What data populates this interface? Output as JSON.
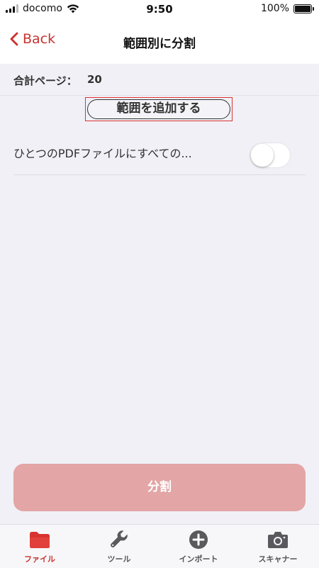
{
  "status_bar": {
    "carrier": "docomo",
    "time": "9:50",
    "battery": "100%"
  },
  "nav": {
    "back_label": "Back",
    "title": "範囲別に分割"
  },
  "summary": {
    "total_pages_label": "合計ページ：",
    "total_pages_value": "20"
  },
  "add_range_label": "範囲を追加する",
  "merge_option": {
    "label": "ひとつのPDFファイルにすべての...",
    "enabled": false
  },
  "split_button_label": "分割",
  "tabs": [
    {
      "label": "ファイル",
      "icon": "folder-icon",
      "active": true
    },
    {
      "label": "ツール",
      "icon": "wrench-icon",
      "active": false
    },
    {
      "label": "インポート",
      "icon": "plus-circle-icon",
      "active": false
    },
    {
      "label": "スキャナー",
      "icon": "camera-icon",
      "active": false
    }
  ],
  "colors": {
    "accent": "#c8322f",
    "split_button_bg": "#e3a5a5",
    "background": "#f0f0f6"
  }
}
